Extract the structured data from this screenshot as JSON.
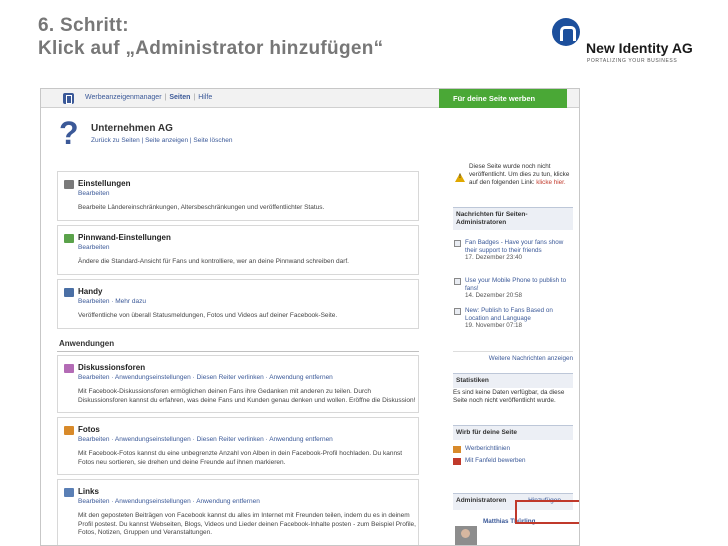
{
  "slide": {
    "title_line1": "6. Schritt:",
    "title_line2": "Klick auf „Administrator hinzufügen“"
  },
  "logo": {
    "name": "New Identity AG",
    "tagline": "PORTALIZING YOUR BUSINESS",
    "color": "#1c4f9c"
  },
  "topbar": {
    "nav": [
      "Werbeanzeigenmanager",
      "Seiten",
      "Hilfe"
    ],
    "promote_button": "Für deine Seite werben",
    "promote_color": "#4aa836"
  },
  "page": {
    "name": "Unternehmen AG",
    "links": [
      "Zurück zu Seiten",
      "Seite anzeigen",
      "Seite löschen"
    ]
  },
  "settings": [
    {
      "title": "Einstellungen",
      "links": [
        "Bearbeiten"
      ],
      "desc": "Bearbeite Ländereinschränkungen, Altersbeschränkungen und veröffentlichter Status.",
      "icon": "settings-icon"
    },
    {
      "title": "Pinnwand-Einstellungen",
      "links": [
        "Bearbeiten"
      ],
      "desc": "Ändere die Standard-Ansicht für Fans und kontrolliere, wer an deine Pinnwand schreiben darf.",
      "icon": "wall-icon"
    },
    {
      "title": "Handy",
      "links": [
        "Bearbeiten",
        "Mehr dazu"
      ],
      "desc": "Veröffentliche von überall Statusmeldungen, Fotos und Videos auf deiner Facebook-Seite.",
      "icon": "mobile-icon"
    }
  ],
  "applications": {
    "header": "Anwendungen",
    "items": [
      {
        "title": "Diskussionsforen",
        "links": [
          "Bearbeiten",
          "Anwendungseinstellungen",
          "Diesen Reiter verlinken",
          "Anwendung entfernen"
        ],
        "desc": "Mit Facebook-Diskussionsforen ermöglichen deinen Fans ihre Gedanken mit anderen zu teilen. Durch Diskussionsforen kannst du erfahren, was deine Fans und Kunden genau denken und wollen. Eröffne die Diskussion!",
        "icon": "discussion-icon"
      },
      {
        "title": "Fotos",
        "links": [
          "Bearbeiten",
          "Anwendungseinstellungen",
          "Diesen Reiter verlinken",
          "Anwendung entfernen"
        ],
        "desc": "Mit Facebook-Fotos kannst du eine unbegrenzte Anzahl von Alben in dein Facebook-Profil hochladen. Du kannst Fotos neu sortieren, sie drehen und deine Freunde auf ihnen markieren.",
        "icon": "photos-icon"
      },
      {
        "title": "Links",
        "links": [
          "Bearbeiten",
          "Anwendungseinstellungen",
          "Anwendung entfernen"
        ],
        "desc": "Mit den geposteten Beiträgen von Facebook kannst du alles im Internet mit Freunden teilen, indem du es in deinem Profil postest. Du kannst Webseiten, Blogs, Videos und Lieder deinen Facebook-Inhalte posten - zum Beispiel Profile, Fotos, Notizen, Gruppen und Veranstaltungen.",
        "icon": "links-icon"
      }
    ]
  },
  "sidebar": {
    "warning": {
      "text": "Diese Seite wurde noch nicht veröffentlicht. Um dies zu tun, klicke auf den folgenden Link:",
      "link": "klicke hier."
    },
    "news_header": "Nachrichten für Seiten-Administratoren",
    "news": [
      {
        "text": "Fan Badges - Have your fans show their support to their friends",
        "date": "17. Dezember 23:40"
      },
      {
        "text": "Use your Mobile Phone to publish to fans!",
        "date": "14. Dezember 20:58"
      },
      {
        "text": "New: Publish to Fans Based on Location and Language",
        "date": "19. November 07:18"
      }
    ],
    "more_news": "Weitere Nachrichten anzeigen",
    "stats_header": "Statistiken",
    "stats_text": "Es sind keine Daten verfügbar, da diese Seite noch nicht veröffentlicht wurde.",
    "promote_header": "Wirb für deine Seite",
    "promote_links": [
      "Werberichtlinien",
      "Mit Fanfeld bewerben"
    ],
    "admins_header": "Administratoren",
    "add_link": "Hinzufügen",
    "admin_name": "Matthias Thürling",
    "highlight_color": "#c0392b"
  }
}
